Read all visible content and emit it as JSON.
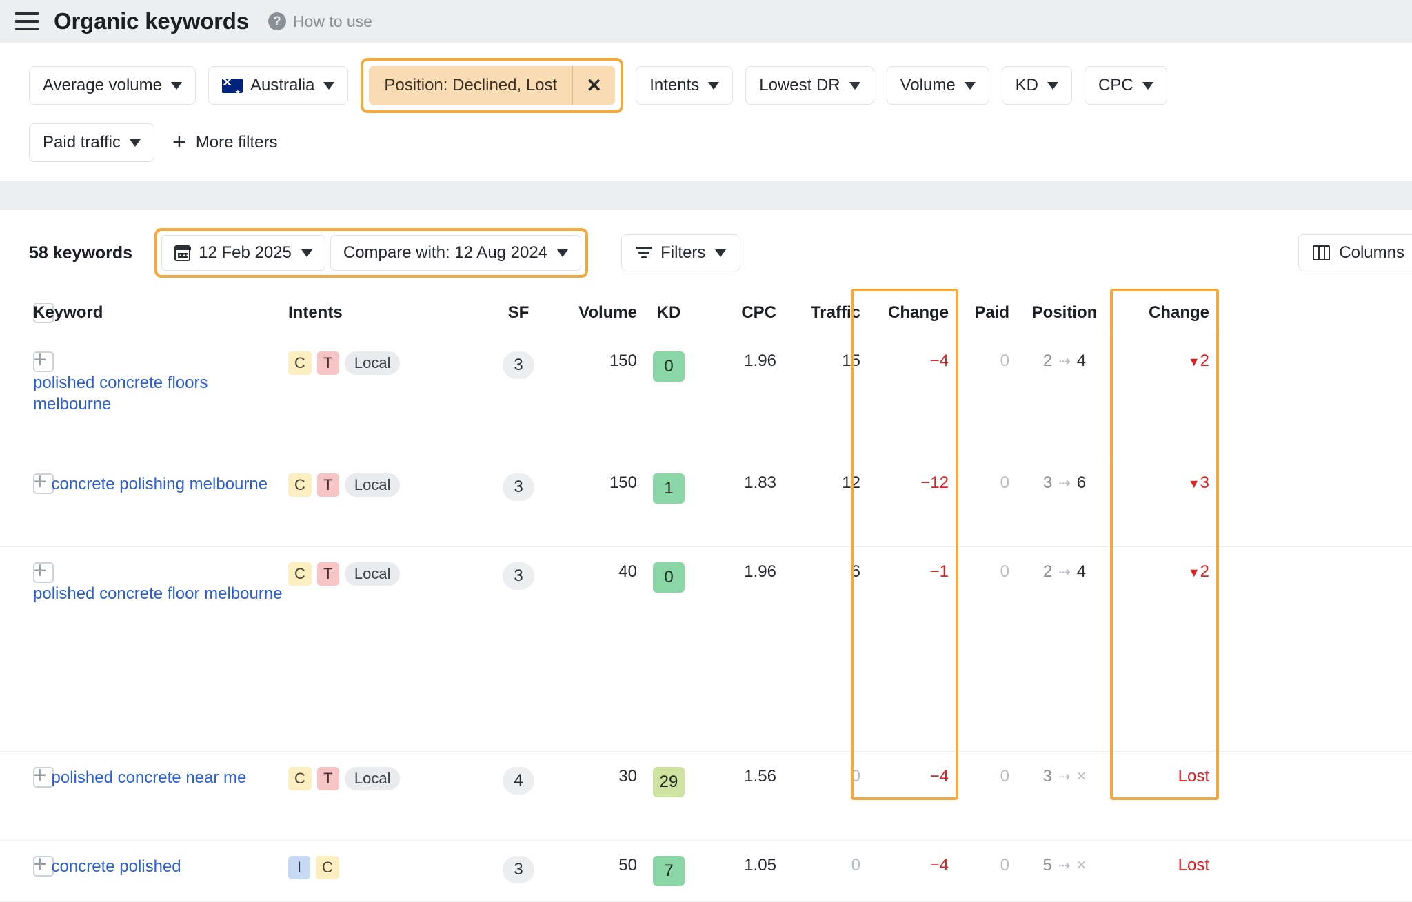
{
  "header": {
    "menu_icon": "hamburger-icon",
    "title": "Organic keywords",
    "help_icon": "question-circle-icon",
    "help_label": "How to use"
  },
  "filters": {
    "row1": [
      {
        "label": "Average volume",
        "type": "dropdown"
      },
      {
        "label": "Australia",
        "type": "dropdown",
        "icon": "australia-flag-icon"
      },
      {
        "label": "Position: Declined, Lost",
        "type": "active-chip",
        "clear_icon": "close-icon",
        "highlighted": true
      },
      {
        "label": "Intents",
        "type": "dropdown"
      },
      {
        "label": "Lowest DR",
        "type": "dropdown"
      },
      {
        "label": "Volume",
        "type": "dropdown"
      },
      {
        "label": "KD",
        "type": "dropdown"
      },
      {
        "label": "CPC",
        "type": "dropdown"
      }
    ],
    "row2": [
      {
        "label": "Paid traffic",
        "type": "dropdown"
      }
    ],
    "more_filters_label": "More filters",
    "more_filters_icon": "plus-icon"
  },
  "toolbar": {
    "keyword_count": "58 keywords",
    "date_label": "12 Feb 2025",
    "date_icon": "calendar-icon",
    "compare_label": "Compare with: 12 Aug 2024",
    "filters_label": "Filters",
    "filters_icon": "filter-icon",
    "columns_label": "Columns",
    "columns_icon": "columns-icon"
  },
  "table": {
    "columns": [
      "Keyword",
      "Intents",
      "SF",
      "Volume",
      "KD",
      "CPC",
      "Traffic",
      "Change",
      "Paid",
      "Position",
      "Change"
    ],
    "rows": [
      {
        "keyword": "polished concrete floors melbourne",
        "intents": [
          "C",
          "T",
          "Local"
        ],
        "sf": "3",
        "volume": "150",
        "kd": "0",
        "kd_color": "#8bd6a5",
        "cpc": "1.96",
        "traffic": "15",
        "traffic_muted": false,
        "change": "−4",
        "paid": "0",
        "pos_from": "2",
        "pos_to": "4",
        "pos_change": "2",
        "pos_change_type": "down"
      },
      {
        "keyword": "concrete polishing melbourne",
        "intents": [
          "C",
          "T",
          "Local"
        ],
        "sf": "3",
        "volume": "150",
        "kd": "1",
        "kd_color": "#8bd6a5",
        "cpc": "1.83",
        "traffic": "12",
        "traffic_muted": false,
        "change": "−12",
        "paid": "0",
        "pos_from": "3",
        "pos_to": "6",
        "pos_change": "3",
        "pos_change_type": "down"
      },
      {
        "keyword": "polished concrete floor melbourne",
        "intents": [
          "C",
          "T",
          "Local"
        ],
        "sf": "3",
        "volume": "40",
        "kd": "0",
        "kd_color": "#8bd6a5",
        "cpc": "1.96",
        "traffic": "6",
        "traffic_muted": false,
        "change": "−1",
        "paid": "0",
        "pos_from": "2",
        "pos_to": "4",
        "pos_change": "2",
        "pos_change_type": "down"
      },
      {
        "keyword": "polished concrete near me",
        "intents": [
          "C",
          "T",
          "Local"
        ],
        "sf": "4",
        "volume": "30",
        "kd": "29",
        "kd_color": "#cfe3a0",
        "cpc": "1.56",
        "traffic": "0",
        "traffic_muted": true,
        "change": "−4",
        "paid": "0",
        "pos_from": "3",
        "pos_to": "×",
        "pos_change": "Lost",
        "pos_change_type": "lost"
      },
      {
        "keyword": "concrete polished",
        "intents": [
          "I",
          "C"
        ],
        "sf": "3",
        "volume": "50",
        "kd": "7",
        "kd_color": "#8bd6a5",
        "cpc": "1.05",
        "traffic": "0",
        "traffic_muted": true,
        "change": "−4",
        "paid": "0",
        "pos_from": "5",
        "pos_to": "×",
        "pos_change": "Lost",
        "pos_change_type": "lost"
      }
    ]
  },
  "colors": {
    "highlight": "#f5a93a",
    "chip_bg": "#fadcb4",
    "link": "#2b5fd9",
    "negative": "#e02020"
  }
}
